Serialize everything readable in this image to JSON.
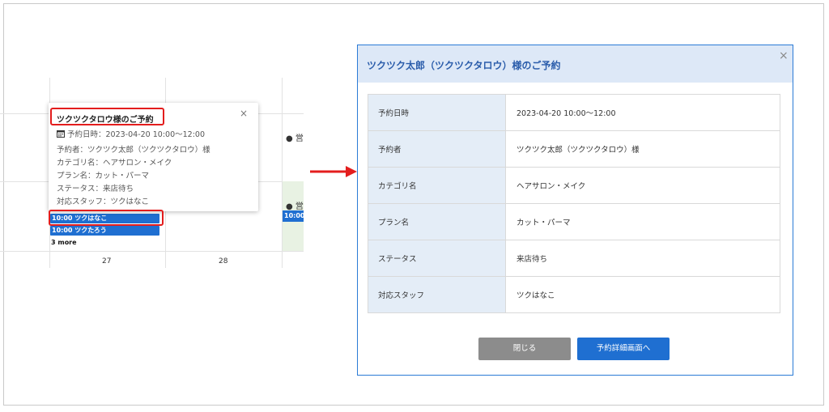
{
  "calendar": {
    "day_27": "27",
    "day_28": "28",
    "side_items": [
      "● 営",
      "● 営"
    ],
    "side_event": "10:00",
    "events": [
      {
        "label": "10:00 ツクはなこ"
      },
      {
        "label": "10:00 ツクたろう"
      }
    ],
    "more_label": "3 more"
  },
  "popover": {
    "title": "ツクツクタロウ様のご予約",
    "close_glyph": "×",
    "date_label": "予約日時：2023-04-20 10:00〜12:00",
    "lines": [
      "予約者：ツクツク太郎（ツクツクタロウ）様",
      "カテゴリ名：ヘアサロン・メイク",
      "プラン名：カット・パーマ",
      "ステータス：来店待ち",
      "対応スタッフ：ツクはなこ"
    ]
  },
  "modal": {
    "title": "ツクツク太郎（ツクツクタロウ）様のご予約",
    "close_glyph": "×",
    "rows": [
      {
        "label": "予約日時",
        "value": "2023-04-20 10:00〜12:00"
      },
      {
        "label": "予約者",
        "value": "ツクツク太郎（ツクツクタロウ）様"
      },
      {
        "label": "カテゴリ名",
        "value": "ヘアサロン・メイク"
      },
      {
        "label": "プラン名",
        "value": "カット・パーマ"
      },
      {
        "label": "ステータス",
        "value": "来店待ち"
      },
      {
        "label": "対応スタッフ",
        "value": "ツクはなこ"
      }
    ],
    "close_button": "閉じる",
    "detail_button": "予約詳細画面へ"
  },
  "colors": {
    "accent_blue": "#1f6fd1",
    "highlight_red": "#e31d1d",
    "header_bg": "#dde8f7",
    "label_bg": "#e4edf7"
  }
}
